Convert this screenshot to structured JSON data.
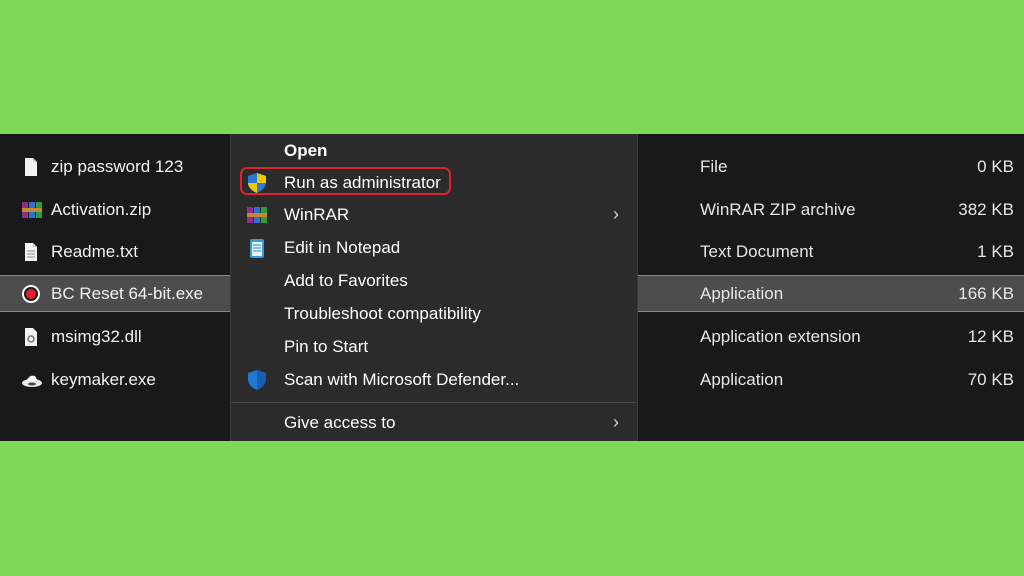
{
  "files": [
    {
      "name": "zip password 123",
      "type": "File",
      "size": "0 KB",
      "icon": "text-file-icon"
    },
    {
      "name": "Activation.zip",
      "type": "WinRAR ZIP archive",
      "size": "382 KB",
      "icon": "winrar-icon"
    },
    {
      "name": "Readme.txt",
      "type": "Text Document",
      "size": "1 KB",
      "icon": "text-file-icon"
    },
    {
      "name": "BC Reset 64-bit.exe",
      "type": "Application",
      "size": "166 KB",
      "icon": "record-icon"
    },
    {
      "name": "msimg32.dll",
      "type": "Application extension",
      "size": "12 KB",
      "icon": "dll-file-icon"
    },
    {
      "name": "keymaker.exe",
      "type": "Application",
      "size": "70 KB",
      "icon": "keymaker-icon"
    }
  ],
  "context_menu": {
    "items": [
      {
        "label": "Open",
        "icon": "",
        "bold": true
      },
      {
        "label": "Run as administrator",
        "icon": "uac-shield-icon"
      },
      {
        "label": "WinRAR",
        "icon": "winrar-icon",
        "submenu": true
      },
      {
        "label": "Edit in Notepad",
        "icon": "notepad-icon"
      },
      {
        "label": "Add to Favorites",
        "icon": ""
      },
      {
        "label": "Troubleshoot compatibility",
        "icon": ""
      },
      {
        "label": "Pin to Start",
        "icon": ""
      },
      {
        "label": "Scan with Microsoft Defender...",
        "icon": "defender-shield-icon"
      },
      {
        "label": "Give access to",
        "icon": "",
        "submenu": true
      }
    ],
    "chevron": "›"
  },
  "colors": {
    "background": "#7ed957",
    "explorer_bg": "#191919",
    "menu_bg": "#2b2b2b",
    "selected_row": "#4d4d4d",
    "highlight": "#e0202a"
  }
}
